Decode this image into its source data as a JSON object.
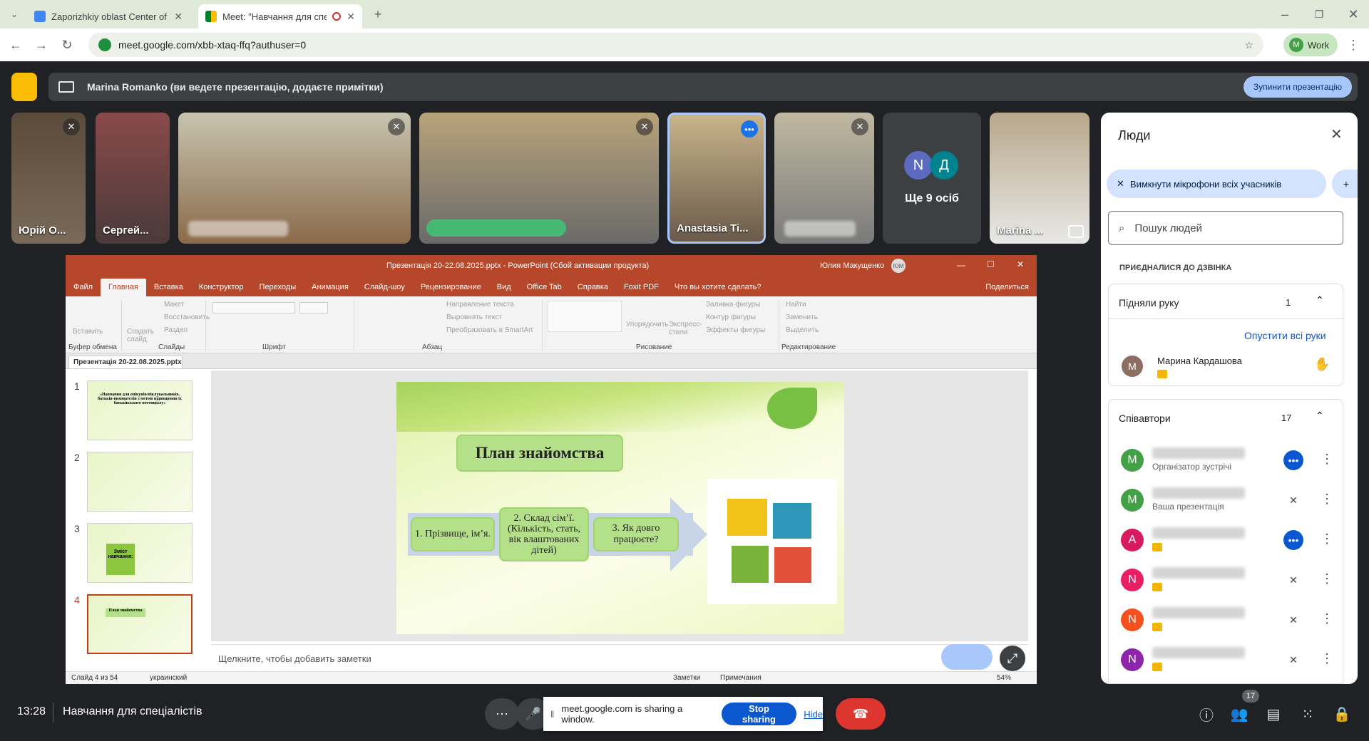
{
  "browser": {
    "tabs": [
      {
        "title": "Zaporizhkiy oblast Center of So"
      },
      {
        "title": "Meet: \"Навчання для спеці"
      }
    ],
    "url": "meet.google.com/xbb-xtaq-ffq?authuser=0",
    "profile_label": "Work",
    "profile_initial": "M"
  },
  "presenting_bar": {
    "text": "Marina Romanko (ви ведете презентацію, додаєте примітки)",
    "stop_label": "Зупинити презентацію"
  },
  "tiles": [
    {
      "name": "Юрій О..."
    },
    {
      "name": "Сергей..."
    },
    {
      "name": ""
    },
    {
      "name": ""
    },
    {
      "name": "Anastasia Ti..."
    },
    {
      "name": ""
    },
    {
      "name": "Ще 9 осіб",
      "initials": [
        "N",
        "Д"
      ]
    },
    {
      "name": "Marina ..."
    }
  ],
  "powerpoint": {
    "title": "Презентація 20-22.08.2025.pptx  -  PowerPoint (Сбой активации продукта)",
    "user": "Юлия Макущенко",
    "user_initials": "ЮМ",
    "menu_tabs": [
      "Файл",
      "Главная",
      "Вставка",
      "Конструктор",
      "Переходы",
      "Анимация",
      "Слайд-шоу",
      "Рецензирование",
      "Вид",
      "Office Tab",
      "Справка",
      "Foxit PDF",
      "Что вы хотите сделать?",
      "Поделиться"
    ],
    "ribbon": {
      "paste": "Вставить",
      "clipboard": "Буфер обмена",
      "create_slide": "Создать слайд",
      "layout": "Макет",
      "reset": "Восстановить",
      "section": "Раздел",
      "slides": "Слайды",
      "font": "Шрифт",
      "paragraph": "Абзац",
      "text_direction": "Направление текста",
      "align_text": "Выровнять текст",
      "smartart": "Преобразовать в SmartArt",
      "arrange": "Упорядочить",
      "quick_styles": "Экспресс-стили",
      "fill": "Заливка фигуры",
      "outline": "Контур фигуры",
      "effects": "Эффекты фигуры",
      "drawing": "Рисование",
      "find": "Найти",
      "replace": "Заменить",
      "select": "Выделить",
      "editing": "Редактирование"
    },
    "doc_tab": "Презентація 20-22.08.2025.pptx",
    "thumbnails": [
      {
        "num": "1",
        "text": "«Навчання для опікунів/піклувальників, батьків-вихователів з метою підвищення їх батьківського потенціалу»"
      },
      {
        "num": "2",
        "text": ""
      },
      {
        "num": "3",
        "text": "Зміст навчання:"
      },
      {
        "num": "4",
        "text": "План знайомства"
      }
    ],
    "slide": {
      "title": "План знайомства",
      "boxes": [
        "1. Прізвище, ім’я.",
        "2. Склад сім’ї. (Кількість, стать, вік влаштованих дітей)",
        "3. Як довго працюєте?"
      ]
    },
    "notes_placeholder": "Щелкните, чтобы добавить заметки",
    "status": {
      "slide_count": "Слайд 4 из 54",
      "language": "украинский",
      "notes": "Заметки",
      "comments": "Примечания",
      "zoom": "54%"
    }
  },
  "people_panel": {
    "title": "Люди",
    "mute_all": "Вимкнути мікрофони всіх учасників",
    "search_placeholder": "Пошук людей",
    "joined_label": "ПРИЄДНАЛИСЯ ДО ДЗВІНКА",
    "raised_hands": {
      "label": "Підняли руку",
      "count": "1",
      "lower_all": "Опустити всі руки",
      "person": "Марина Кардашова",
      "initial": "М"
    },
    "contributors": {
      "label": "Співавтори",
      "count": "17"
    },
    "people": [
      {
        "initial": "M",
        "color": "#43a047",
        "subtitle": "Організатор зустрічі"
      },
      {
        "initial": "M",
        "color": "#43a047",
        "subtitle": "Ваша презентація"
      },
      {
        "initial": "A",
        "color": "#d81b60",
        "subtitle": ""
      },
      {
        "initial": "N",
        "color": "#e91e63",
        "subtitle": ""
      },
      {
        "initial": "N",
        "color": "#f4511e",
        "subtitle": ""
      },
      {
        "initial": "N",
        "color": "#8e24aa",
        "subtitle": ""
      }
    ]
  },
  "bottom": {
    "time": "13:28",
    "meeting_name": "Навчання для спеціалістів",
    "people_count": "17",
    "share_notice": "meet.google.com is sharing a window.",
    "stop_sharing": "Stop sharing",
    "hide": "Hide"
  }
}
